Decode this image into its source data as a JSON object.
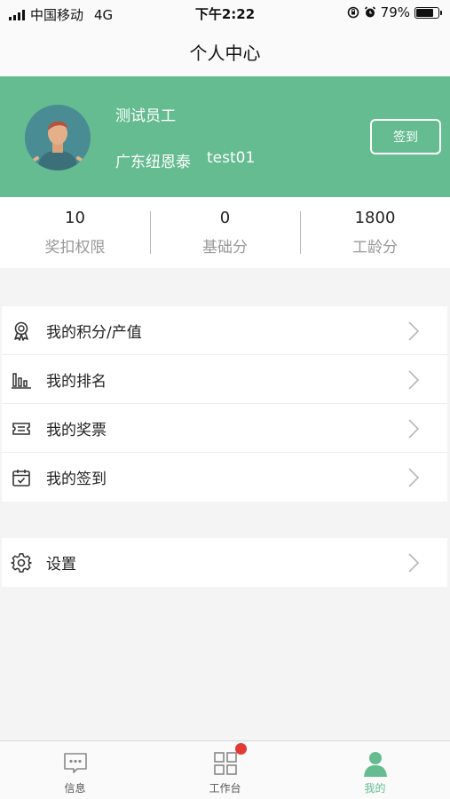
{
  "status_bar": {
    "carrier": "中国移动",
    "network": "4G",
    "time": "下午2:22",
    "battery_text": "79%",
    "battery_level": 0.79
  },
  "nav": {
    "title": "个人中心"
  },
  "profile": {
    "name": "测试员工",
    "org": "广东纽恩泰",
    "account": "test01",
    "checkin_label": "签到",
    "background_color": "#65bc91"
  },
  "stats": [
    {
      "value": "10",
      "label": "奖扣权限"
    },
    {
      "value": "0",
      "label": "基础分"
    },
    {
      "value": "1800",
      "label": "工龄分"
    }
  ],
  "menu_primary": [
    {
      "label": "我的积分/产值",
      "icon": "award-icon"
    },
    {
      "label": "我的排名",
      "icon": "bar-chart-icon"
    },
    {
      "label": "我的奖票",
      "icon": "ticket-icon"
    },
    {
      "label": "我的签到",
      "icon": "calendar-check-icon"
    }
  ],
  "menu_secondary": [
    {
      "label": "设置",
      "icon": "gear-icon"
    }
  ],
  "tabs": [
    {
      "label": "信息",
      "icon": "message-icon",
      "active": false,
      "badge": false
    },
    {
      "label": "工作台",
      "icon": "grid-icon",
      "active": false,
      "badge": true
    },
    {
      "label": "我的",
      "icon": "person-icon",
      "active": true,
      "badge": false
    }
  ],
  "colors": {
    "accent": "#65bc91",
    "badge": "#e53935"
  }
}
